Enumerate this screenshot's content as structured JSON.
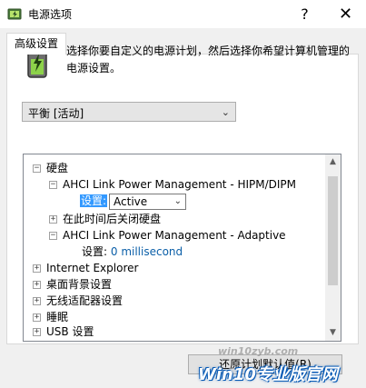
{
  "window": {
    "title": "电源选项",
    "help_label": "?",
    "close_label": "✕"
  },
  "tab": {
    "label": "高级设置"
  },
  "description": "选择你要自定义的电源计划，然后选择你希望计算机管理的电源设置。",
  "plan_select": {
    "value": "平衡 [活动]"
  },
  "tree": {
    "expanded_symbol": "−",
    "collapsed_symbol": "+",
    "hard_disk": "硬盘",
    "ahci_hipm": "AHCI Link Power Management - HIPM/DIPM",
    "setting_label": "设置:",
    "hipm_value": "Active",
    "turn_off_disk": "在此时间后关闭硬盘",
    "ahci_adaptive": "AHCI Link Power Management - Adaptive",
    "adaptive_setting": "设置:",
    "adaptive_value": "0 millisecond",
    "internet_explorer": "Internet Explorer",
    "desktop_background": "桌面背景设置",
    "wireless_adapter": "无线适配器设置",
    "sleep": "睡眠",
    "usb": "USB 设置"
  },
  "restore_button": "还原计划默认值(R)",
  "watermark": {
    "site": "win10zyb.com",
    "logo": "Win10专业版官网"
  }
}
